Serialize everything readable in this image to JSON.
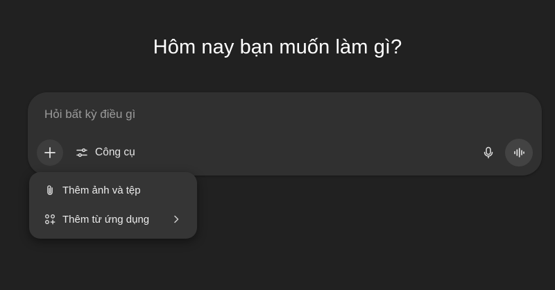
{
  "heading": "Hôm nay bạn muốn làm gì?",
  "composer": {
    "placeholder": "Hỏi bất kỳ điều gì",
    "value": "",
    "tools_label": "Công cụ"
  },
  "menu": {
    "items": [
      {
        "label": "Thêm ảnh và tệp",
        "icon": "paperclip-icon"
      },
      {
        "label": "Thêm từ ứng dụng",
        "icon": "apps-add-icon",
        "has_submenu": true
      }
    ]
  },
  "colors": {
    "background": "#212121",
    "composer": "#303030",
    "menu": "#353535",
    "text": "#ececec",
    "placeholder": "#9b9b9b"
  }
}
